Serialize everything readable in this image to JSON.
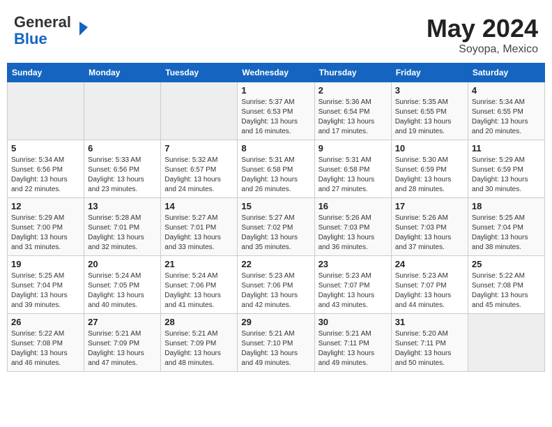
{
  "header": {
    "logo_line1": "General",
    "logo_line2": "Blue",
    "title": "May 2024",
    "location": "Soyopa, Mexico"
  },
  "weekdays": [
    "Sunday",
    "Monday",
    "Tuesday",
    "Wednesday",
    "Thursday",
    "Friday",
    "Saturday"
  ],
  "weeks": [
    [
      {
        "day": "",
        "info": ""
      },
      {
        "day": "",
        "info": ""
      },
      {
        "day": "",
        "info": ""
      },
      {
        "day": "1",
        "info": "Sunrise: 5:37 AM\nSunset: 6:53 PM\nDaylight: 13 hours\nand 16 minutes."
      },
      {
        "day": "2",
        "info": "Sunrise: 5:36 AM\nSunset: 6:54 PM\nDaylight: 13 hours\nand 17 minutes."
      },
      {
        "day": "3",
        "info": "Sunrise: 5:35 AM\nSunset: 6:55 PM\nDaylight: 13 hours\nand 19 minutes."
      },
      {
        "day": "4",
        "info": "Sunrise: 5:34 AM\nSunset: 6:55 PM\nDaylight: 13 hours\nand 20 minutes."
      }
    ],
    [
      {
        "day": "5",
        "info": "Sunrise: 5:34 AM\nSunset: 6:56 PM\nDaylight: 13 hours\nand 22 minutes."
      },
      {
        "day": "6",
        "info": "Sunrise: 5:33 AM\nSunset: 6:56 PM\nDaylight: 13 hours\nand 23 minutes."
      },
      {
        "day": "7",
        "info": "Sunrise: 5:32 AM\nSunset: 6:57 PM\nDaylight: 13 hours\nand 24 minutes."
      },
      {
        "day": "8",
        "info": "Sunrise: 5:31 AM\nSunset: 6:58 PM\nDaylight: 13 hours\nand 26 minutes."
      },
      {
        "day": "9",
        "info": "Sunrise: 5:31 AM\nSunset: 6:58 PM\nDaylight: 13 hours\nand 27 minutes."
      },
      {
        "day": "10",
        "info": "Sunrise: 5:30 AM\nSunset: 6:59 PM\nDaylight: 13 hours\nand 28 minutes."
      },
      {
        "day": "11",
        "info": "Sunrise: 5:29 AM\nSunset: 6:59 PM\nDaylight: 13 hours\nand 30 minutes."
      }
    ],
    [
      {
        "day": "12",
        "info": "Sunrise: 5:29 AM\nSunset: 7:00 PM\nDaylight: 13 hours\nand 31 minutes."
      },
      {
        "day": "13",
        "info": "Sunrise: 5:28 AM\nSunset: 7:01 PM\nDaylight: 13 hours\nand 32 minutes."
      },
      {
        "day": "14",
        "info": "Sunrise: 5:27 AM\nSunset: 7:01 PM\nDaylight: 13 hours\nand 33 minutes."
      },
      {
        "day": "15",
        "info": "Sunrise: 5:27 AM\nSunset: 7:02 PM\nDaylight: 13 hours\nand 35 minutes."
      },
      {
        "day": "16",
        "info": "Sunrise: 5:26 AM\nSunset: 7:03 PM\nDaylight: 13 hours\nand 36 minutes."
      },
      {
        "day": "17",
        "info": "Sunrise: 5:26 AM\nSunset: 7:03 PM\nDaylight: 13 hours\nand 37 minutes."
      },
      {
        "day": "18",
        "info": "Sunrise: 5:25 AM\nSunset: 7:04 PM\nDaylight: 13 hours\nand 38 minutes."
      }
    ],
    [
      {
        "day": "19",
        "info": "Sunrise: 5:25 AM\nSunset: 7:04 PM\nDaylight: 13 hours\nand 39 minutes."
      },
      {
        "day": "20",
        "info": "Sunrise: 5:24 AM\nSunset: 7:05 PM\nDaylight: 13 hours\nand 40 minutes."
      },
      {
        "day": "21",
        "info": "Sunrise: 5:24 AM\nSunset: 7:06 PM\nDaylight: 13 hours\nand 41 minutes."
      },
      {
        "day": "22",
        "info": "Sunrise: 5:23 AM\nSunset: 7:06 PM\nDaylight: 13 hours\nand 42 minutes."
      },
      {
        "day": "23",
        "info": "Sunrise: 5:23 AM\nSunset: 7:07 PM\nDaylight: 13 hours\nand 43 minutes."
      },
      {
        "day": "24",
        "info": "Sunrise: 5:23 AM\nSunset: 7:07 PM\nDaylight: 13 hours\nand 44 minutes."
      },
      {
        "day": "25",
        "info": "Sunrise: 5:22 AM\nSunset: 7:08 PM\nDaylight: 13 hours\nand 45 minutes."
      }
    ],
    [
      {
        "day": "26",
        "info": "Sunrise: 5:22 AM\nSunset: 7:08 PM\nDaylight: 13 hours\nand 46 minutes."
      },
      {
        "day": "27",
        "info": "Sunrise: 5:21 AM\nSunset: 7:09 PM\nDaylight: 13 hours\nand 47 minutes."
      },
      {
        "day": "28",
        "info": "Sunrise: 5:21 AM\nSunset: 7:09 PM\nDaylight: 13 hours\nand 48 minutes."
      },
      {
        "day": "29",
        "info": "Sunrise: 5:21 AM\nSunset: 7:10 PM\nDaylight: 13 hours\nand 49 minutes."
      },
      {
        "day": "30",
        "info": "Sunrise: 5:21 AM\nSunset: 7:11 PM\nDaylight: 13 hours\nand 49 minutes."
      },
      {
        "day": "31",
        "info": "Sunrise: 5:20 AM\nSunset: 7:11 PM\nDaylight: 13 hours\nand 50 minutes."
      },
      {
        "day": "",
        "info": ""
      }
    ]
  ]
}
